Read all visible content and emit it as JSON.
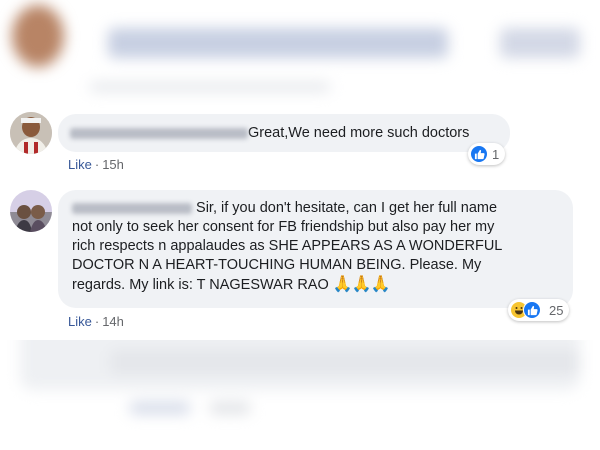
{
  "comments": [
    {
      "author_hidden": true,
      "text": "Great,We need more such doctors",
      "like_label": "Like",
      "separator": "·",
      "time": "15h",
      "reactions": {
        "types": [
          "like-icon"
        ],
        "count": "1"
      }
    },
    {
      "author_hidden": true,
      "lines": [
        "Sir, if you don't hesitate, can I get her full name",
        "not only to seek her consent for FB friendship but also pay her my",
        "rich respects n appalaudes as SHE APPEARS AS A WONDERFUL",
        "DOCTOR N A HEART-TOUCHING HUMAN BEING. Please. My",
        "regards. My link is: T NAGESWAR RAO"
      ],
      "emoji": "🙏🙏🙏",
      "like_label": "Like",
      "separator": "·",
      "time": "14h",
      "reactions": {
        "types": [
          "haha-icon",
          "like-icon"
        ],
        "count": "25"
      }
    }
  ],
  "colors": {
    "bubble": "#f0f2f5",
    "like_link": "#385898",
    "like_reaction": "#1877f2",
    "haha_reaction": "#f7c531",
    "meta_text": "#65676b"
  }
}
